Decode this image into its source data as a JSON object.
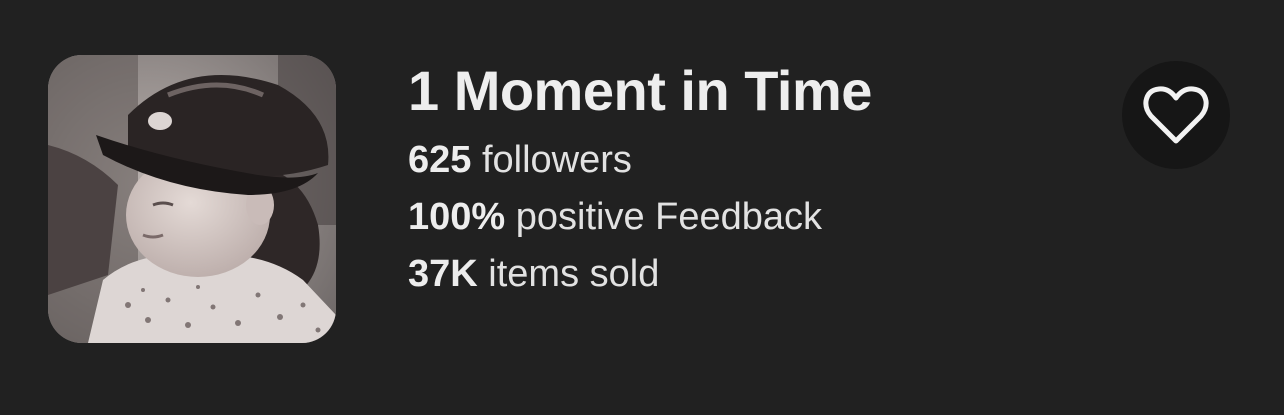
{
  "seller": {
    "name": "1 Moment in Time",
    "avatar_icon": "vintage-child-photo",
    "stats": {
      "followers_count": "625",
      "followers_label": " followers",
      "feedback_percent": "100%",
      "feedback_label": " positive Feedback",
      "items_sold_count": "37K",
      "items_sold_label": " items sold"
    }
  },
  "actions": {
    "follow_icon": "heart-outline-icon"
  },
  "colors": {
    "background": "#212121",
    "button_background": "#161616",
    "text": "#ececec"
  }
}
